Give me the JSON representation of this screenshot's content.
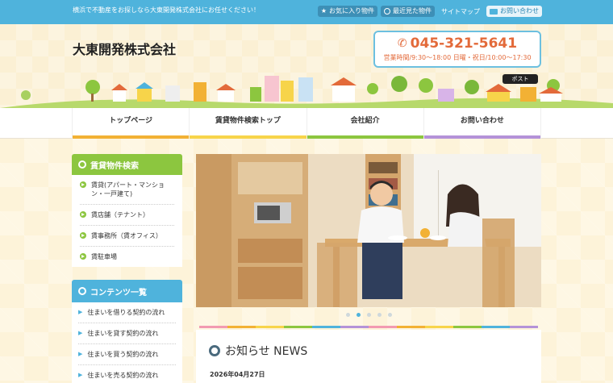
{
  "topbar": {
    "tagline": "横浜で不動産をお探しなら大東開発株式会社にお任せください！",
    "favorites_label": "お気に入り物件",
    "recent_label": "最近見た物件",
    "sitemap_label": "サイトマップ",
    "contact_label": "お問い合わせ"
  },
  "header": {
    "company_name": "大東開発株式会社",
    "phone": "045-321-5641",
    "hours": "営業時間/9:30〜18:00 日曜・祝日/10:00〜17:30",
    "tweet_label": "ポスト"
  },
  "nav": {
    "items": [
      {
        "label": "トップページ",
        "color": "#f2b134"
      },
      {
        "label": "賃貸物件検索トップ",
        "color": "#f7d44a"
      },
      {
        "label": "会社紹介",
        "color": "#8cc63f"
      },
      {
        "label": "お問い合わせ",
        "color": "#b492d8"
      }
    ]
  },
  "sidebar": {
    "search_heading": "賃貸物件検索",
    "search_items": [
      {
        "label": "賃貸(アパート・マンション・一戸建て)"
      },
      {
        "label": "賃店舗（テナント）"
      },
      {
        "label": "賃事務所（賃オフィス）"
      },
      {
        "label": "賃駐車場"
      }
    ],
    "contents_heading": "コンテンツ一覧",
    "contents_items": [
      {
        "label": "住まいを借りる契約の流れ"
      },
      {
        "label": "住まいを貸す契約の流れ"
      },
      {
        "label": "住まいを買う契約の流れ"
      },
      {
        "label": "住まいを売る契約の流れ"
      }
    ]
  },
  "slider": {
    "slide_count": 5,
    "active_index": 1
  },
  "news": {
    "heading": "お知らせ NEWS",
    "date": "2026年04月27日"
  },
  "colors": {
    "accent_blue": "#4fb3dc",
    "accent_green": "#8cc63f",
    "phone_orange": "#e36a3a"
  }
}
